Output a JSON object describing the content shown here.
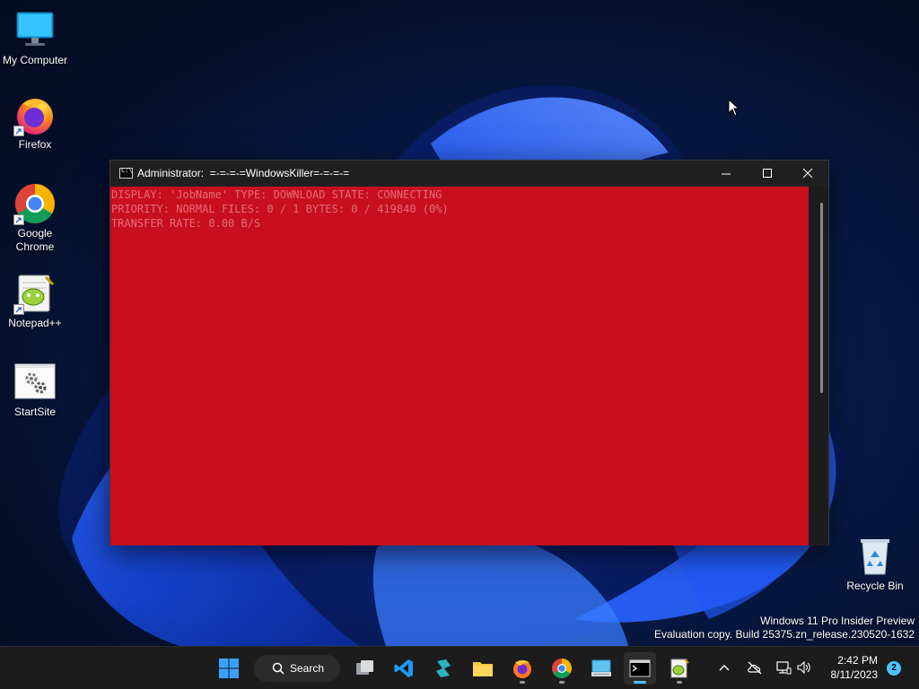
{
  "desktop": {
    "icons": [
      {
        "label": "My Computer",
        "icon": "monitor-icon"
      },
      {
        "label": "Firefox",
        "icon": "firefox-icon"
      },
      {
        "label": "Google Chrome",
        "icon": "chrome-icon"
      },
      {
        "label": "Notepad++",
        "icon": "notepadpp-icon"
      },
      {
        "label": "StartSite",
        "icon": "gear-icon"
      },
      {
        "label": "Recycle Bin",
        "icon": "recycle-bin-icon"
      }
    ],
    "watermark": {
      "line1": "Windows 11 Pro Insider Preview",
      "line2": "Evaluation copy. Build 25375.zn_release.230520-1632"
    }
  },
  "console": {
    "title": "Administrator:  =-=-=-=WindowsKiller=-=-=-=",
    "lines": [
      "DISPLAY: 'JobName' TYPE: DOWNLOAD STATE: CONNECTING",
      "PRIORITY: NORMAL FILES: 0 / 1 BYTES: 0 / 419840 (0%)",
      "TRANSFER RATE: 0.00 B/S"
    ],
    "background_color": "#c80f1e"
  },
  "taskbar": {
    "search_label": "Search",
    "apps": [
      "start-icon",
      "task-view-icon",
      "vscode-icon",
      "azure-data-studio-icon",
      "file-explorer-icon",
      "firefox-icon",
      "chrome-icon",
      "remote-keyboard-icon",
      "terminal-icon",
      "notepadpp-icon"
    ],
    "clock": {
      "time": "2:42 PM",
      "date": "8/11/2023"
    },
    "notification_count": "2"
  },
  "colors": {
    "accent": "#4cc2ff",
    "taskbar": "#1c1c1c"
  }
}
